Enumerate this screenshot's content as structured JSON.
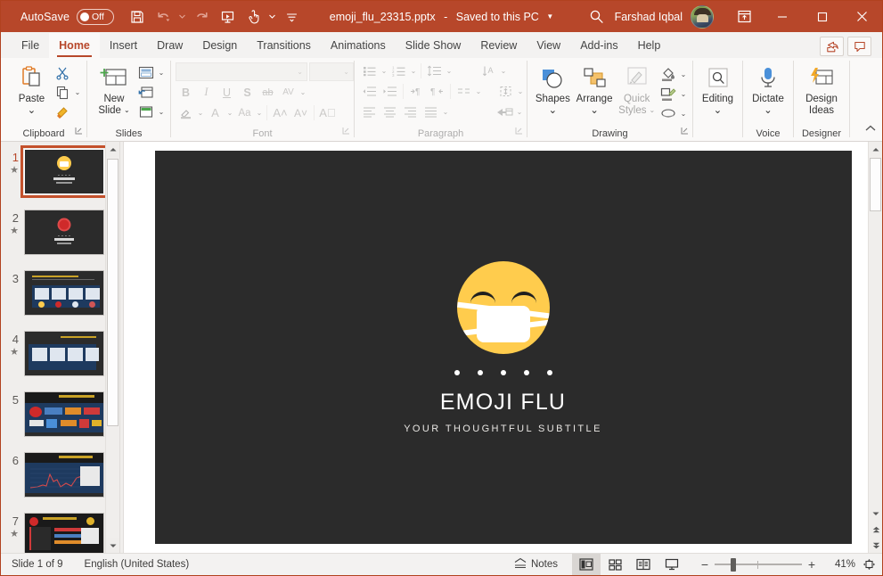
{
  "titlebar": {
    "autosave_label": "AutoSave",
    "autosave_state": "Off",
    "document_title": "emoji_flu_23315.pptx",
    "save_state": "Saved to this PC",
    "separator": "-",
    "user_name": "Farshad Iqbal",
    "qat": [
      {
        "name": "save-icon",
        "tooltip": "Save"
      },
      {
        "name": "undo-icon",
        "tooltip": "Undo"
      },
      {
        "name": "redo-icon",
        "tooltip": "Redo"
      },
      {
        "name": "start-from-beginning-icon",
        "tooltip": "Start From Beginning"
      },
      {
        "name": "touch-mouse-mode-icon",
        "tooltip": "Touch/Mouse Mode"
      },
      {
        "name": "customize-quick-access-toolbar-icon",
        "tooltip": "Customize Quick Access Toolbar"
      }
    ],
    "window_buttons": [
      "minimize",
      "maximize",
      "close"
    ],
    "accent_color": "#b7472a"
  },
  "tabs": [
    {
      "label": "File",
      "active": false
    },
    {
      "label": "Home",
      "active": true
    },
    {
      "label": "Insert",
      "active": false
    },
    {
      "label": "Draw",
      "active": false
    },
    {
      "label": "Design",
      "active": false
    },
    {
      "label": "Transitions",
      "active": false
    },
    {
      "label": "Animations",
      "active": false
    },
    {
      "label": "Slide Show",
      "active": false
    },
    {
      "label": "Review",
      "active": false
    },
    {
      "label": "View",
      "active": false
    },
    {
      "label": "Add-ins",
      "active": false
    },
    {
      "label": "Help",
      "active": false
    }
  ],
  "tabs_right": [
    {
      "name": "share-button",
      "label": "Share"
    },
    {
      "name": "comments-button",
      "label": "Comments"
    }
  ],
  "ribbon": {
    "groups": [
      {
        "name": "clipboard",
        "label": "Clipboard",
        "buttons": [
          {
            "label": "Paste",
            "caret": true
          },
          {
            "label": "Cut"
          },
          {
            "label": "Copy"
          },
          {
            "label": "Format Painter"
          }
        ]
      },
      {
        "name": "slides",
        "label": "Slides",
        "buttons": [
          {
            "label": "New",
            "label2": "Slide",
            "caret": true
          },
          {
            "label": "Layout"
          },
          {
            "label": "Reset"
          },
          {
            "label": "Section"
          }
        ]
      },
      {
        "name": "font",
        "label": "Font",
        "font_name": "",
        "font_size": "",
        "buttons": [
          "Bold",
          "Italic",
          "Underline",
          "Text Shadow",
          "Strikethrough",
          "Character Spacing",
          "Text Highlight Color",
          "Font Color",
          "Change Case",
          "Increase Font Size",
          "Decrease Font Size",
          "Clear All Formatting"
        ]
      },
      {
        "name": "paragraph",
        "label": "Paragraph",
        "buttons": [
          "Bullets",
          "Numbering",
          "Line Spacing",
          "Text Direction",
          "Decrease Indent",
          "Increase Indent",
          "Align Text Left to Right",
          "Align Text Right to Left",
          "Columns",
          "Align Text",
          "Align Left",
          "Center",
          "Align Right",
          "Justify",
          "Convert to SmartArt"
        ]
      },
      {
        "name": "drawing",
        "label": "Drawing",
        "buttons": [
          {
            "label": "Shapes",
            "caret": true
          },
          {
            "label": "Arrange",
            "caret": true
          },
          {
            "label": "Quick",
            "label2": "Styles",
            "caret": true,
            "disabled": true
          },
          {
            "label": "Shape Fill"
          },
          {
            "label": "Shape Outline"
          },
          {
            "label": "Shape Effects"
          }
        ]
      },
      {
        "name": "editing",
        "label": "",
        "buttons": [
          {
            "label": "Editing",
            "caret": true
          }
        ]
      },
      {
        "name": "voice",
        "label": "Voice",
        "buttons": [
          {
            "label": "Dictate",
            "caret": true
          }
        ]
      },
      {
        "name": "designer",
        "label": "Designer",
        "buttons": [
          {
            "label": "Design",
            "label2": "Ideas"
          }
        ]
      }
    ],
    "collapse_label": "Collapse the Ribbon"
  },
  "thumbnails": {
    "selected_index": 1,
    "slides": [
      {
        "number": "1",
        "has_animation": true,
        "type": "title",
        "selected": true
      },
      {
        "number": "2",
        "has_animation": true,
        "type": "title"
      },
      {
        "number": "3",
        "has_animation": false,
        "type": "content"
      },
      {
        "number": "4",
        "has_animation": true,
        "type": "content"
      },
      {
        "number": "5",
        "has_animation": false,
        "type": "content"
      },
      {
        "number": "6",
        "has_animation": false,
        "type": "chart"
      },
      {
        "number": "7",
        "has_animation": true,
        "type": "content"
      }
    ]
  },
  "slide": {
    "background_color": "#2b2b2b",
    "emoji_name": "face-with-medical-mask-emoji",
    "emoji_color": "#FFCC4D",
    "dots_count": 5,
    "title": "EMOJI FLU",
    "subtitle": "YOUR THOUGHTFUL SUBTITLE"
  },
  "status": {
    "slide_counter": "Slide 1 of 9",
    "language": "English (United States)",
    "notes_label": "Notes",
    "views": [
      {
        "name": "normal-view",
        "label": "Normal",
        "active": true
      },
      {
        "name": "slide-sorter-view",
        "label": "Slide Sorter",
        "active": false
      },
      {
        "name": "reading-view",
        "label": "Reading View",
        "active": false
      },
      {
        "name": "slide-show-view",
        "label": "Slide Show",
        "active": false
      }
    ],
    "zoom_out_label": "−",
    "zoom_in_label": "+",
    "zoom_level": "41%",
    "fit_label": "Fit slide to current window"
  }
}
